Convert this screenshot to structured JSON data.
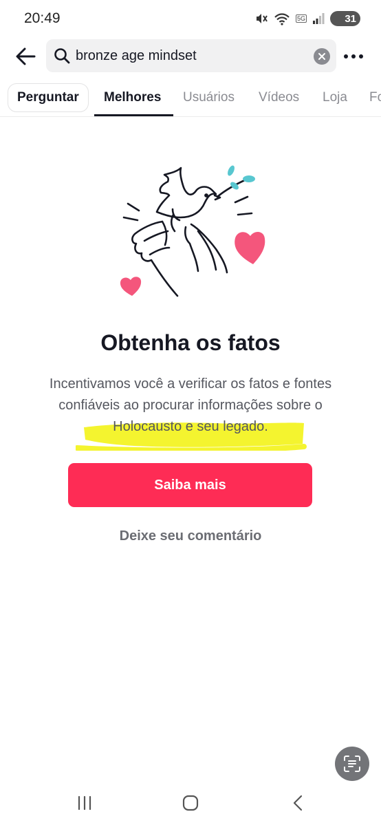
{
  "status_bar": {
    "time": "20:49",
    "network_badge": "5G",
    "battery": "31"
  },
  "search": {
    "query": "bronze age mindset",
    "icon": "search-icon"
  },
  "tabs": {
    "ask": "Perguntar",
    "items": [
      "Melhores",
      "Usuários",
      "Vídeos",
      "Loja",
      "Fo"
    ],
    "active": "Melhores"
  },
  "content": {
    "title": "Obtenha os fatos",
    "description": "Incentivamos você a verificar os fatos e fontes confiáveis ao procurar informações sobre o Holocausto e seu legado.",
    "learn_more": "Saiba mais",
    "comment": "Deixe seu comentário"
  },
  "colors": {
    "accent": "#fe2c55",
    "heart": "#f4567c",
    "leaf": "#58c7d0",
    "highlight": "#f2f20a"
  },
  "icons": [
    "back-arrow-icon",
    "search-icon",
    "clear-icon",
    "more-icon",
    "dove-hands-illustration",
    "scan-text-icon",
    "recent-apps-icon",
    "home-icon",
    "back-icon"
  ]
}
